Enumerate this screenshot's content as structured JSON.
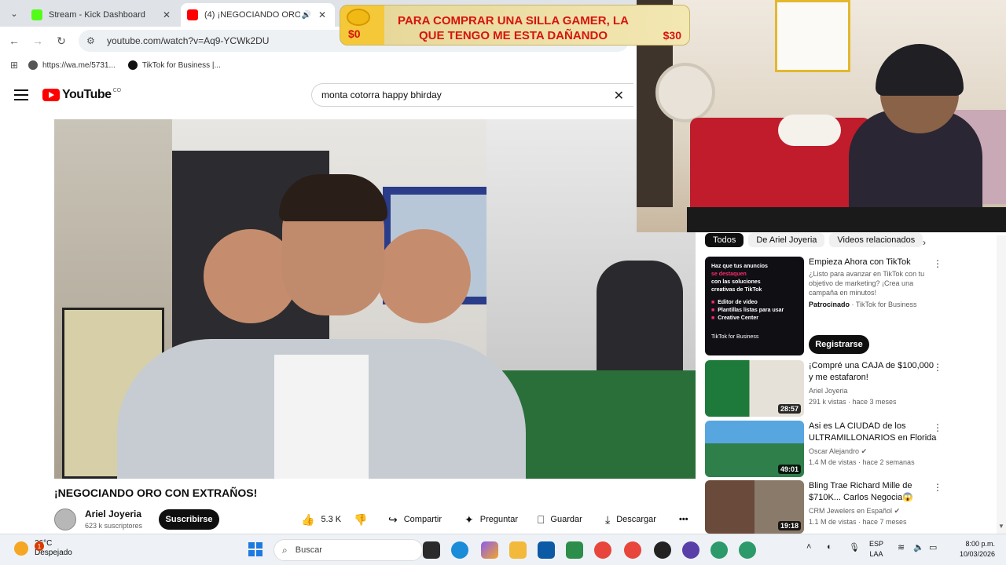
{
  "browser": {
    "tabs": [
      {
        "title": "Stream - Kick Dashboard",
        "favicon_color": "#53fc18"
      },
      {
        "title": "(4) ¡NEGOCIANDO ORO CON EXTRAÑOS! - YouTube",
        "favicon_color": "#ff0000"
      }
    ],
    "url": "youtube.com/watch?v=Aq9-YCWk2DU",
    "bookmarks": [
      {
        "label": "https://wa.me/5731...",
        "icon": "globe-icon"
      },
      {
        "label": "TikTok for Business |...",
        "icon": "tiktok-icon"
      }
    ]
  },
  "donation": {
    "amount_left": "$0",
    "message": "PARA COMPRAR UNA SILLA GAMER, LA QUE TENGO ME ESTA DAÑANDO",
    "amount_right": "$30"
  },
  "youtube": {
    "logo": "YouTube",
    "logo_region": "CO",
    "search_value": "monta cotorra happy bhirday",
    "video": {
      "title": "¡NEGOCIANDO ORO CON EXTRAÑOS!",
      "channel": "Ariel Joyeria",
      "subscribers": "623 k suscriptores",
      "subscribe_label": "Suscribirse",
      "likes": "5.3 K",
      "share": "Compartir",
      "ask": "Preguntar",
      "save": "Guardar",
      "download": "Descargar"
    },
    "sidebar": {
      "chips": [
        "Todos",
        "De Ariel Joyeria",
        "Videos relacionados"
      ],
      "ad": {
        "thumb_lines": [
          "Haz que tus anuncios",
          "se destaquen",
          "con las soluciones",
          "creativas de TikTok"
        ],
        "thumb_bullets": [
          "Editor de video",
          "Plantillas listas para usar",
          "Creative Center"
        ],
        "thumb_brand": "TikTok for Business",
        "title": "Empieza Ahora con TikTok",
        "description": "¿Listo para avanzar en TikTok con tu objetivo de marketing? ¡Crea una campaña en minutos!",
        "sponsored": "Patrocinado",
        "advertiser": "· TikTok for Business",
        "cta": "Registrarse"
      },
      "videos": [
        {
          "title": "¡Compré una CAJA de $100,000 y me estafaron!",
          "channel": "Ariel Joyeria",
          "meta": "291 k vistas · hace 3 meses",
          "duration": "28:57"
        },
        {
          "title": "Asi es LA CIUDAD de los ULTRAMILLONARIOS en Florida",
          "channel": "Oscar Alejandro",
          "meta": "1.4 M de vistas · hace 2 semanas",
          "duration": "49:01"
        },
        {
          "title": "Bling Trae Richard Mille de $710K... Carlos Negocia😱",
          "channel": "CRM Jewelers en Español",
          "meta": "1.1 M de vistas · hace 7 meses",
          "duration": "19:18"
        }
      ]
    }
  },
  "taskbar": {
    "temperature": "26°C",
    "weather": "Despejado",
    "weather_badge": "1",
    "search_placeholder": "Buscar",
    "language": "ESP",
    "region": "LAA",
    "time": "8:00 p.m.",
    "date": "10/03/2026"
  }
}
